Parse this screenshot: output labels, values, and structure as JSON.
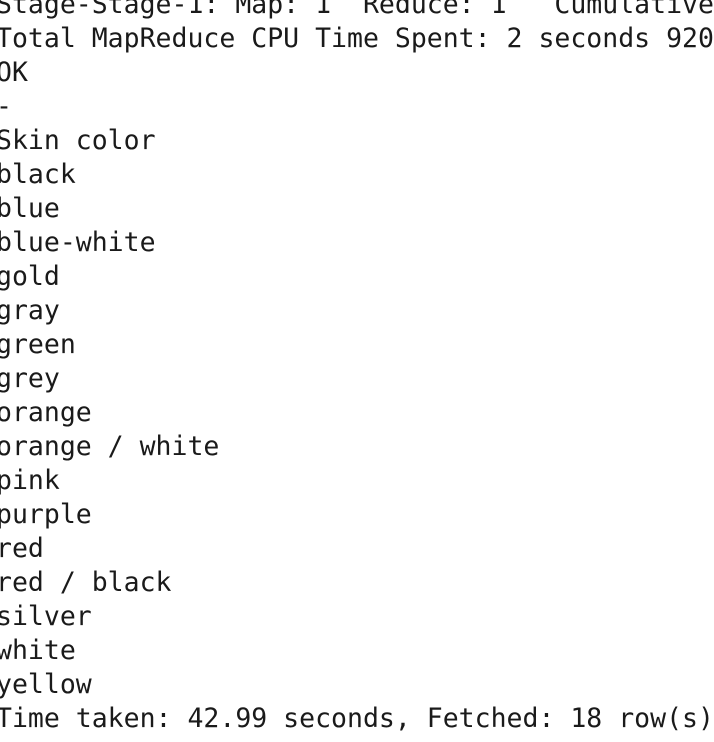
{
  "terminal": {
    "lines": [
      "Stage-Stage-1: Map: 1  Reduce: 1   Cumulative",
      "Total MapReduce CPU Time Spent: 2 seconds 920",
      "OK",
      "-",
      "Skin color",
      "black",
      "blue",
      "blue-white",
      "gold",
      "gray",
      "green",
      "grey",
      "orange",
      "orange / white",
      "pink",
      "purple",
      "red",
      "red / black",
      "silver",
      "white",
      "yellow",
      "Time taken: 42.99 seconds, Fetched: 18 row(s)"
    ],
    "prompt": ""
  }
}
